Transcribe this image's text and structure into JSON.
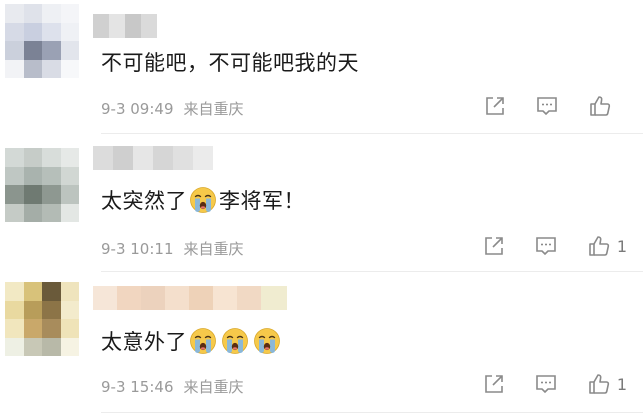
{
  "comments": [
    {
      "text_before": "不可能吧，不可能吧我的天",
      "text_after": "",
      "emoji_count": 0,
      "time": "9-3 09:49",
      "location": "来自重庆",
      "like_count": "",
      "icons": {
        "share": "share-icon",
        "comment": "comment-icon",
        "like": "thumbs-up-icon"
      }
    },
    {
      "text_before": "太突然了",
      "text_after": "李将军！",
      "emoji_count": 1,
      "time": "9-3 10:11",
      "location": "来自重庆",
      "like_count": "1",
      "icons": {
        "share": "share-icon",
        "comment": "comment-icon",
        "like": "thumbs-up-icon"
      }
    },
    {
      "text_before": "太意外了",
      "text_after": "",
      "emoji_count": 3,
      "time": "9-3 15:46",
      "location": "来自重庆",
      "like_count": "1",
      "icons": {
        "share": "share-icon",
        "comment": "comment-icon",
        "like": "thumbs-up-icon"
      }
    }
  ],
  "emoji": {
    "name": "crying-face-emoji",
    "face_color": "#f6c94a",
    "tear_color": "#7fb6e8"
  }
}
